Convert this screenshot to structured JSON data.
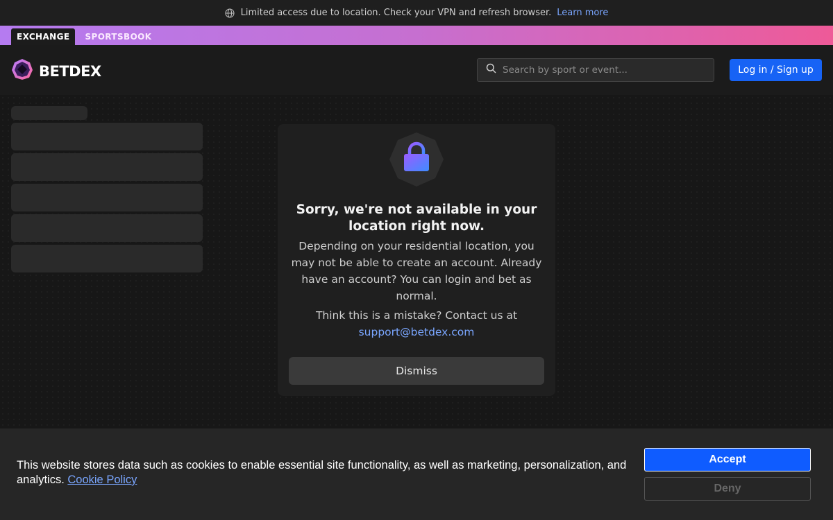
{
  "notice": {
    "icon": "globe-icon",
    "text": "Limited access due to location. Check your VPN and refresh browser.",
    "link_label": "Learn more"
  },
  "product_tabs": [
    {
      "label": "EXCHANGE",
      "active": true
    },
    {
      "label": "SPORTSBOOK",
      "active": false
    }
  ],
  "header": {
    "logo_text": "BETDEX",
    "search_placeholder": "Search by sport or event...",
    "login_label": "Log in / Sign up"
  },
  "modal": {
    "icon": "lock-icon",
    "title": "Sorry, we're not available in your location right now.",
    "body": "Depending on your residential location, you may not be able to create an account. Already have an account? You can login and bet as normal.",
    "contact_text": "Think this is a mistake? Contact us at",
    "contact_email": "support@betdex.com",
    "dismiss_label": "Dismiss"
  },
  "cookie": {
    "text": "This website stores data such as cookies to enable essential site functionality, as well as marketing, personalization, and analytics.",
    "policy_label": "Cookie Policy",
    "accept_label": "Accept",
    "deny_label": "Deny"
  },
  "colors": {
    "accent_blue": "#1763f5",
    "link_blue": "#7aa6ff",
    "gradient_start": "#b57bf0",
    "gradient_end": "#ee5a98"
  }
}
